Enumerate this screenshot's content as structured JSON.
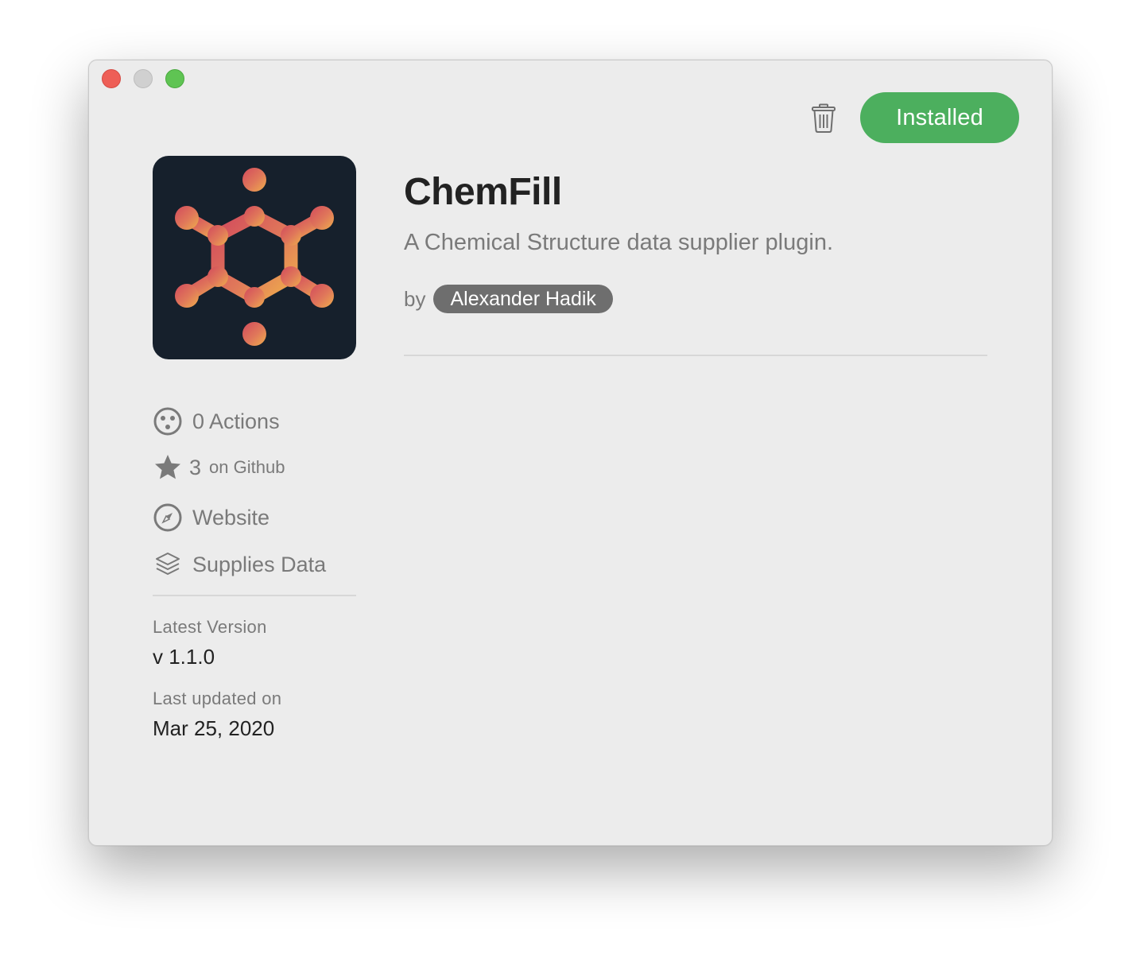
{
  "window": {
    "controls": [
      "close",
      "minimize",
      "zoom"
    ]
  },
  "toolbar": {
    "uninstall_icon": "trash-icon",
    "install_state_label": "Installed",
    "install_state_color": "#4caf5e"
  },
  "plugin": {
    "name": "ChemFill",
    "description": "A Chemical Structure data supplier plugin.",
    "by_label": "by",
    "author": "Alexander Hadik",
    "icon": "molecule-icon",
    "icon_background": "#16202c"
  },
  "meta": {
    "actions": {
      "icon": "face-icon",
      "label": "0 Actions"
    },
    "github": {
      "icon": "star-icon",
      "count": "3",
      "suffix": "on Github"
    },
    "website": {
      "icon": "compass-icon",
      "label": "Website"
    },
    "supplies": {
      "icon": "layers-icon",
      "label": "Supplies Data"
    }
  },
  "details": {
    "latest_version_label": "Latest Version",
    "latest_version_value": "v 1.1.0",
    "last_updated_label": "Last updated on",
    "last_updated_value": "Mar 25, 2020"
  }
}
